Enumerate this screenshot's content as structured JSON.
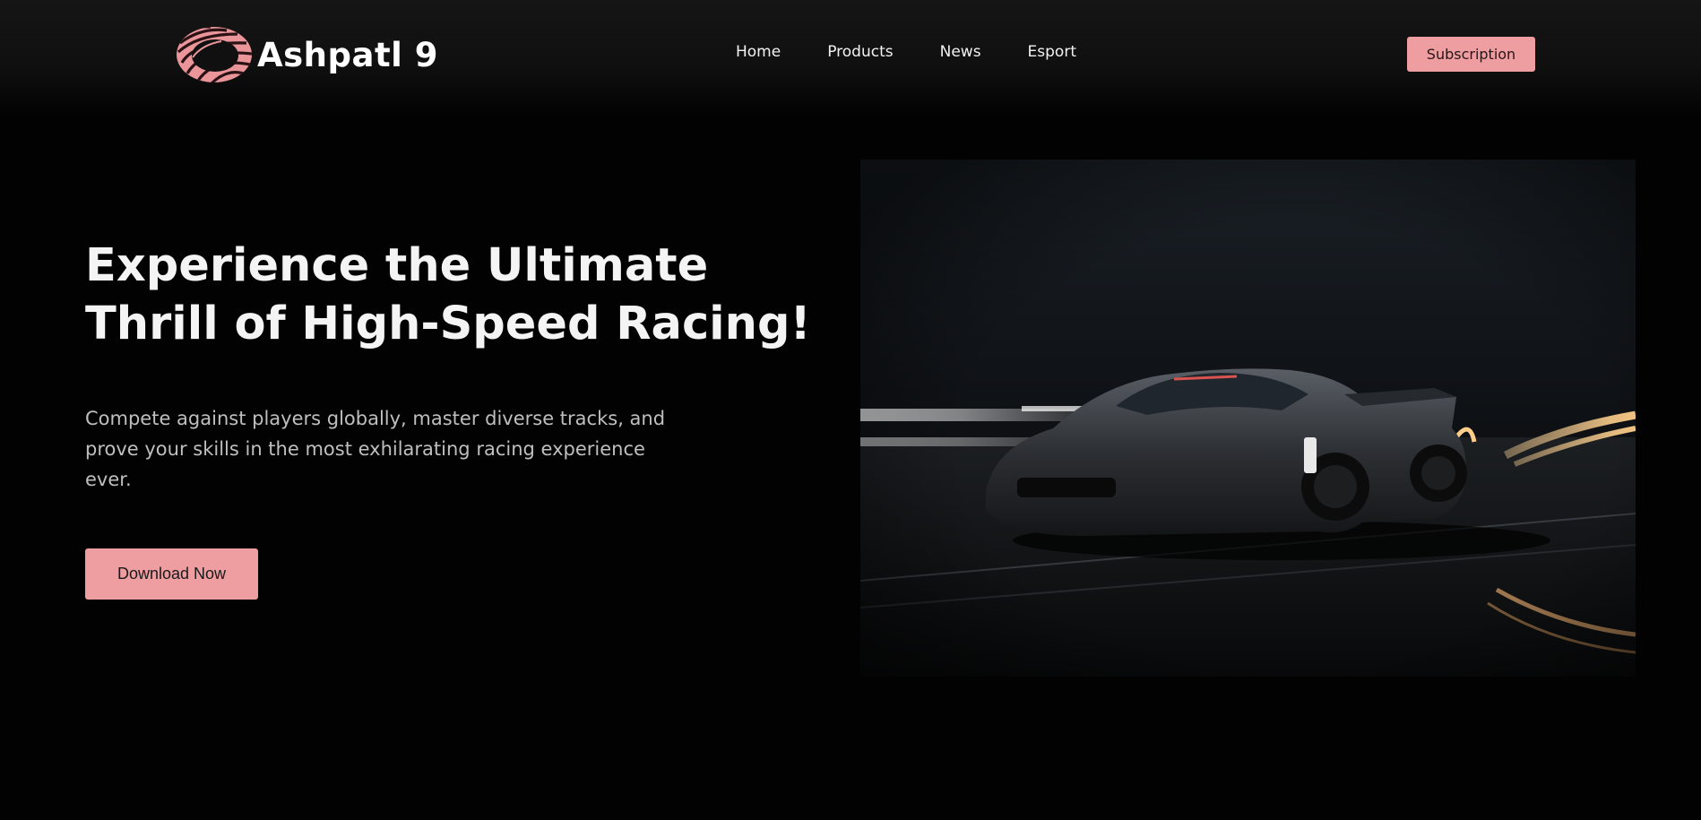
{
  "brand": {
    "name": "Ashpatl 9",
    "logo_icon": "swirl-ring-logo",
    "accent": "#ee9da1"
  },
  "nav": {
    "items": [
      "Home",
      "Products",
      "News",
      "Esport"
    ]
  },
  "header": {
    "subscription_label": "Subscription"
  },
  "hero": {
    "title_line1": "Experience the Ultimate",
    "title_line2": "Thrill of High-Speed Racing!",
    "description": "Compete against players globally, master diverse tracks, and prove your skills in the most exhilarating racing experience ever.",
    "download_label": "Download Now",
    "image": "race-car-photo"
  },
  "colors": {
    "background": "#020202",
    "text": "#f4f4f4",
    "muted_text": "#bfbfbf",
    "button": "#ee9da1"
  }
}
